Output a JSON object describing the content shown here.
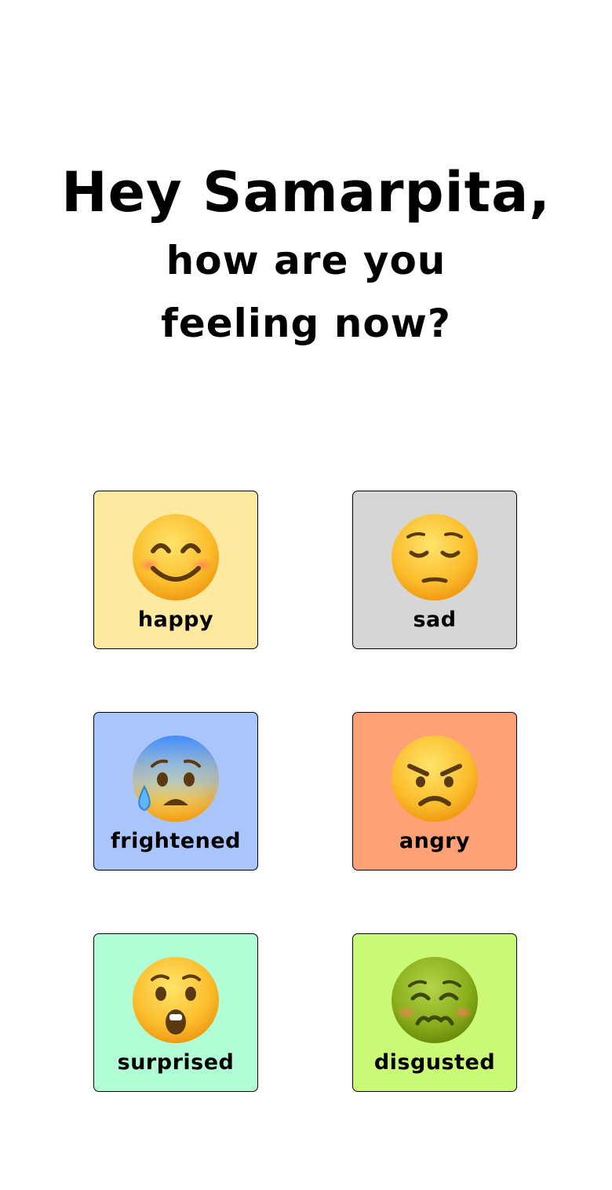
{
  "greeting": {
    "name_line": "Hey Samarpita,",
    "question_line": "how are you feeling now?"
  },
  "moods": [
    {
      "label": "happy",
      "icon": "smiling-face-icon",
      "color": "#fde9a0"
    },
    {
      "label": "sad",
      "icon": "pensive-face-icon",
      "color": "#d6d6d6"
    },
    {
      "label": "frightened",
      "icon": "anxious-face-with-sweat-icon",
      "color": "#aac4fc"
    },
    {
      "label": "angry",
      "icon": "angry-face-icon",
      "color": "#ffa177"
    },
    {
      "label": "surprised",
      "icon": "hushed-face-icon",
      "color": "#b1fdd5"
    },
    {
      "label": "disgusted",
      "icon": "nauseated-face-icon",
      "color": "#c9f976"
    }
  ]
}
